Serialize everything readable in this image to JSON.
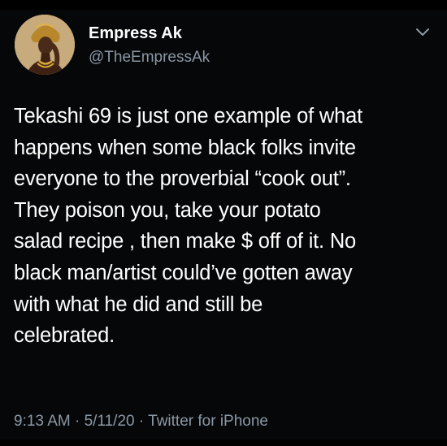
{
  "tweet": {
    "author": {
      "display_name": "Empress Ak",
      "handle": "@TheEmpressAk"
    },
    "text_lines": [
      "Tekashi 69 is just one example of what",
      "happens when some black folks invite",
      "everyone to the proverbial “cook out”.",
      "They poison you, take your potato",
      "salad recipe , then make $ off of it. No",
      "black man/artist could’ve gotten away",
      "with what he did and still be",
      "celebrated."
    ],
    "time": "9:13 AM",
    "date": "5/11/20",
    "separator": "·",
    "source": "Twitter for iPhone"
  },
  "icons": {
    "menu": "chevron-down-icon",
    "avatar": "avatar"
  },
  "colors": {
    "background": "#060708",
    "text": "#ffffff",
    "secondary": "#8b98a5"
  }
}
